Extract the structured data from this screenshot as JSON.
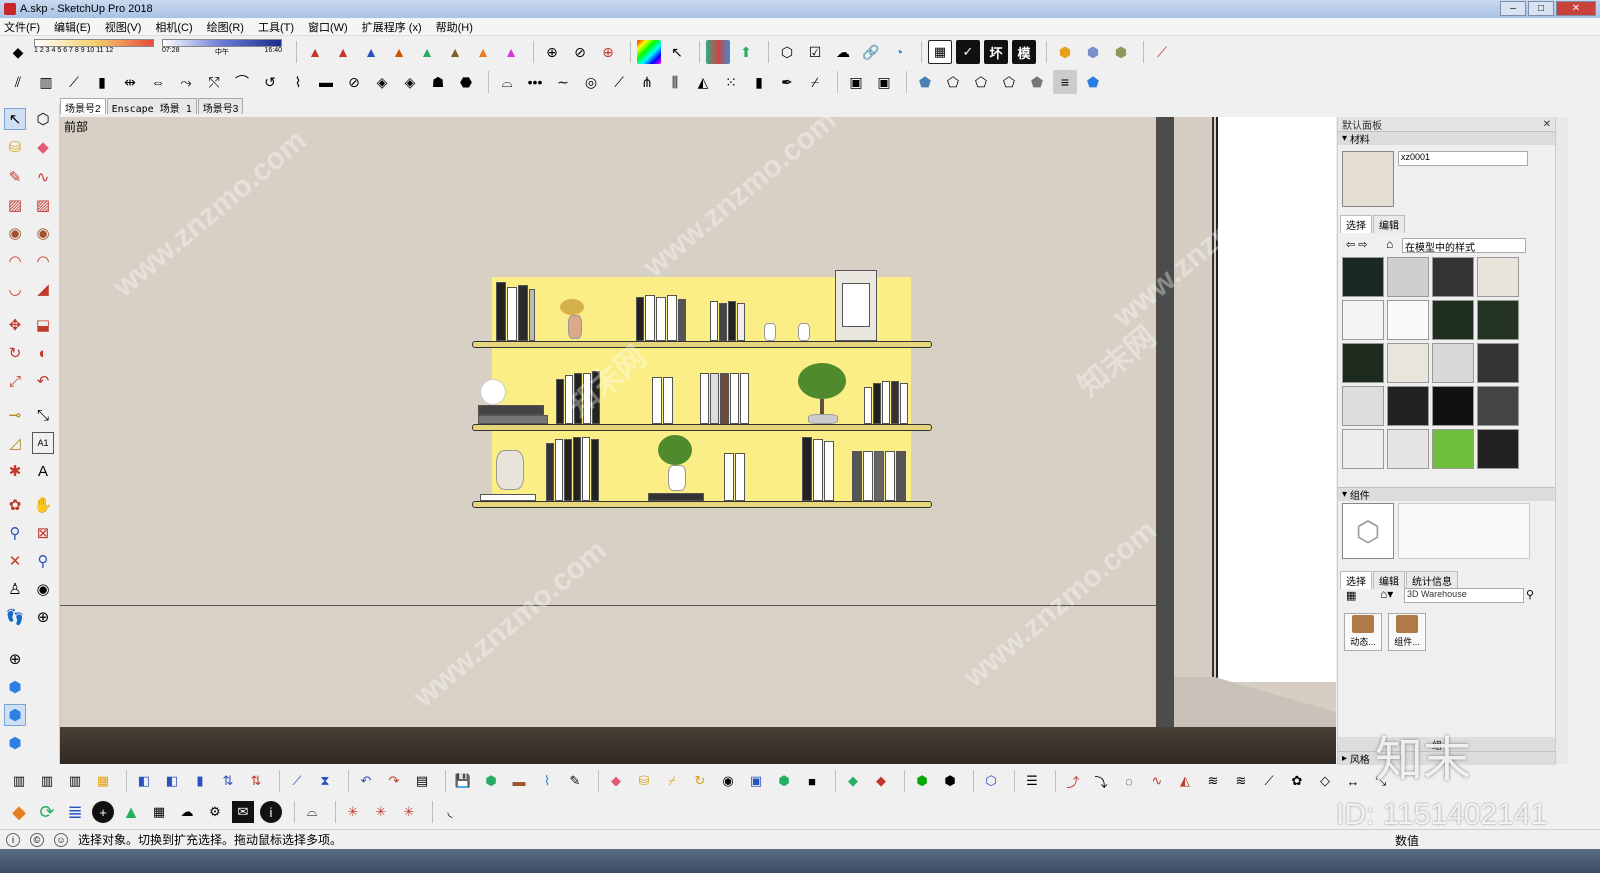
{
  "window": {
    "title": "A.skp - SketchUp Pro 2018"
  },
  "menu": [
    "文件(F)",
    "编辑(E)",
    "视图(V)",
    "相机(C)",
    "绘图(R)",
    "工具(T)",
    "窗口(W)",
    "扩展程序 (x)",
    "帮助(H)"
  ],
  "shadow_slider": {
    "months": "1 2 3 4 5 6 7 8 9 10 11 12",
    "time_start": "07:28",
    "time_mid": "中午",
    "time_end": "16:40"
  },
  "toolbar2_letters": [
    "坏",
    "模"
  ],
  "scene_tabs": [
    "场景号2",
    "Enscape 场景 1",
    "场景号3"
  ],
  "viewport": {
    "view_name": "前部"
  },
  "panel": {
    "title": "默认面板",
    "materials_header": "材料",
    "material_name": "xz0001",
    "tab_select": "选择",
    "tab_edit": "编辑",
    "collection": "在模型中的样式",
    "components_header": "组件",
    "comp_tab_select": "选择",
    "comp_tab_edit": "编辑",
    "comp_tab_stats": "统计信息",
    "search_placeholder": "3D Warehouse",
    "items": [
      "动态...",
      "组件..."
    ],
    "footer_partial": "组",
    "style_header": "风格"
  },
  "status": {
    "message": "选择对象。切换到扩充选择。拖动鼠标选择多项。",
    "value_label": "数值"
  },
  "watermark": {
    "site": "www.znzmo.com",
    "brand": "知末网",
    "id": "ID: 1151402141",
    "logo": "知末"
  },
  "colors": {
    "wall": "#d8d0c5",
    "shelf_back": "#fbee87",
    "floor": "#3b322a"
  }
}
